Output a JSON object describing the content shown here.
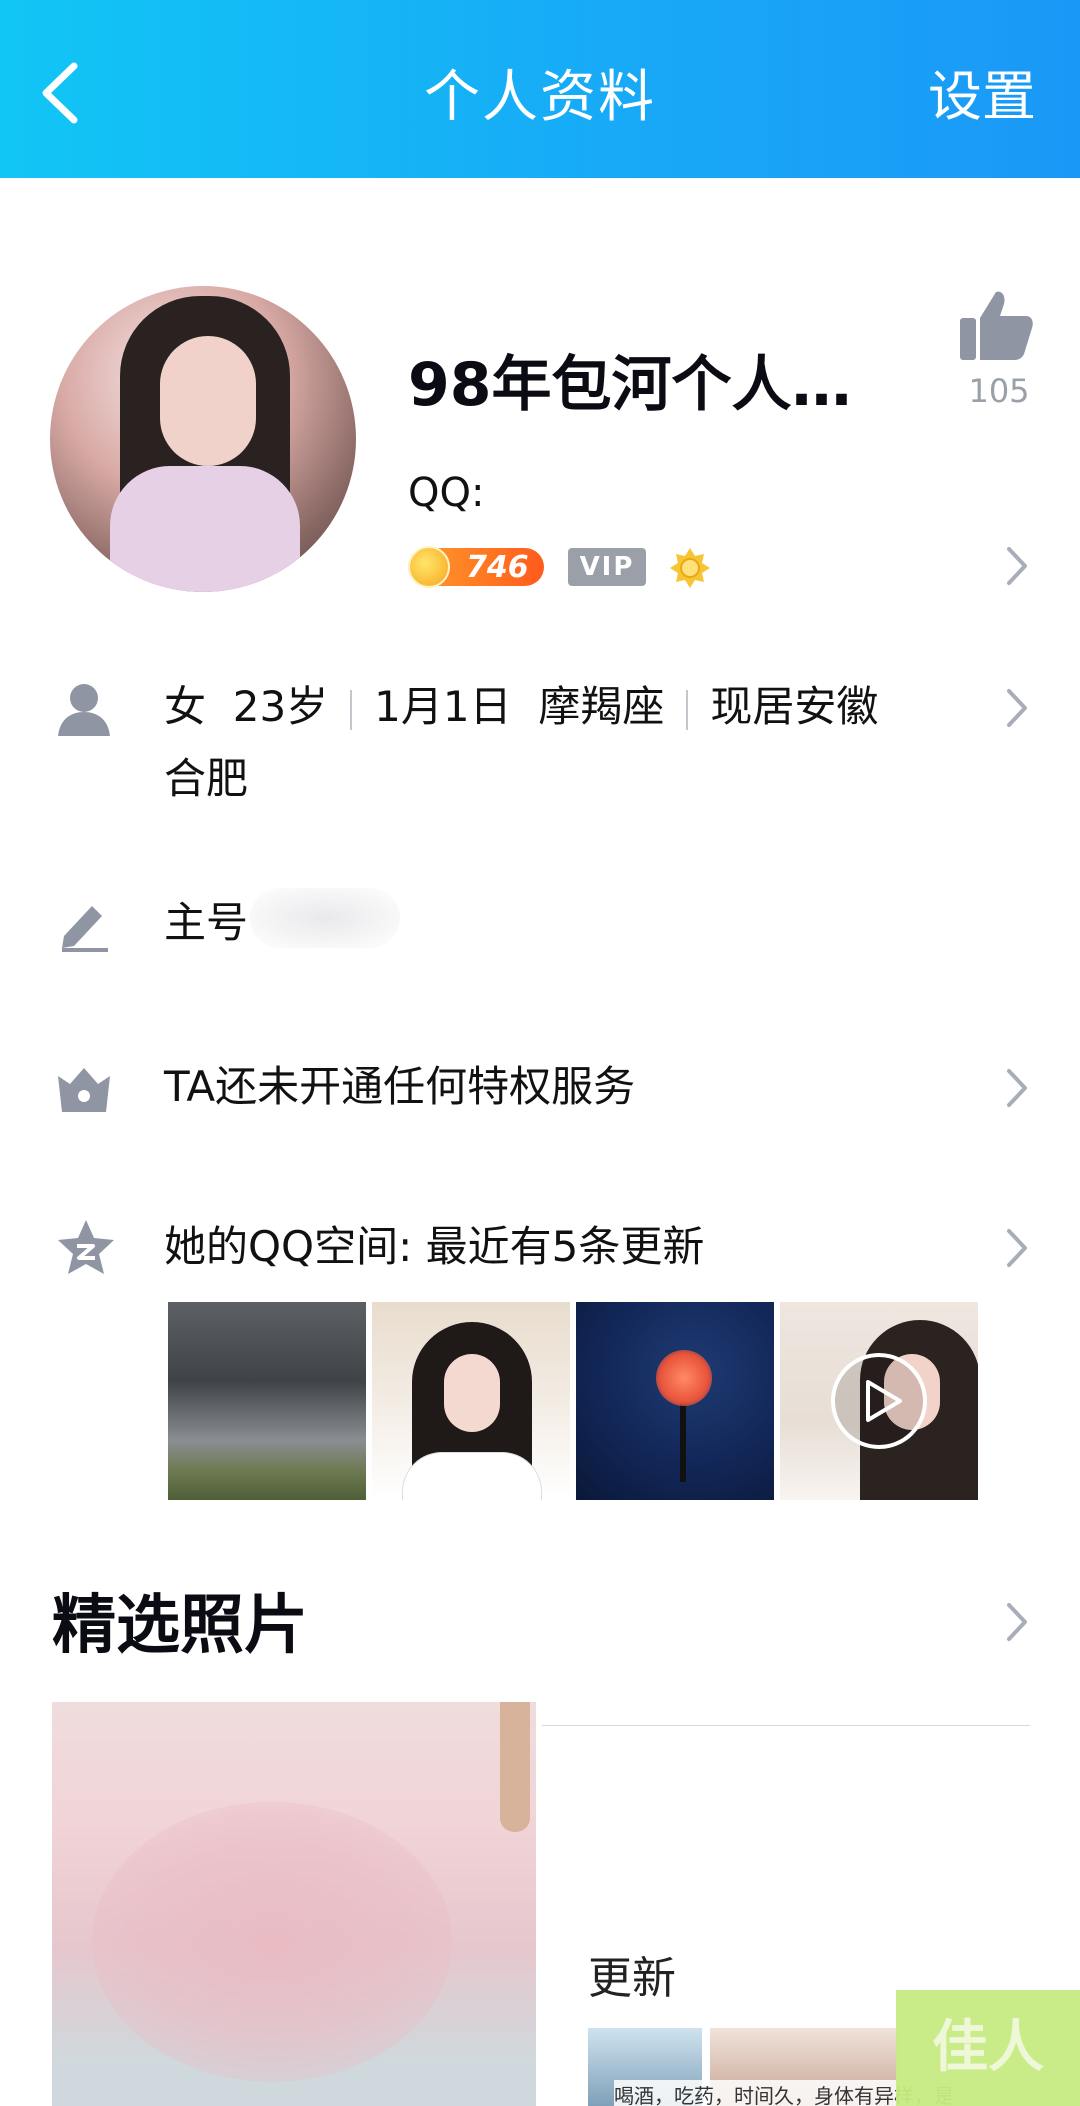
{
  "header": {
    "title": "个人资料",
    "right_label": "设置",
    "colors": {
      "gradient_start": "#11c6f5",
      "gradient_end": "#1a98f7"
    }
  },
  "profile": {
    "nickname": "98年包河个人…",
    "qq_label": "QQ:",
    "likes": "105",
    "coin_count": "746",
    "vip_label": "VIP"
  },
  "info_rows": {
    "basic_line1": [
      "女",
      "23岁",
      "1月1日",
      "摩羯座",
      "现居安徽"
    ],
    "basic_line2": "合肥",
    "main_account": "主号",
    "privilege": "TA还未开通任何特权服务",
    "qzone": "她的QQ空间: 最近有5条更新"
  },
  "photos": {
    "section_title": "精选照片",
    "right_update": "更新",
    "right_caption": "喝酒，吃药，时间久，身体有异样，是"
  },
  "watermark": "佳人",
  "icons": [
    "back-chevron-icon",
    "thumbs-up-icon",
    "person-icon",
    "pencil-icon",
    "crown-icon",
    "qzone-star-icon",
    "play-icon",
    "chevron-right-icon"
  ]
}
